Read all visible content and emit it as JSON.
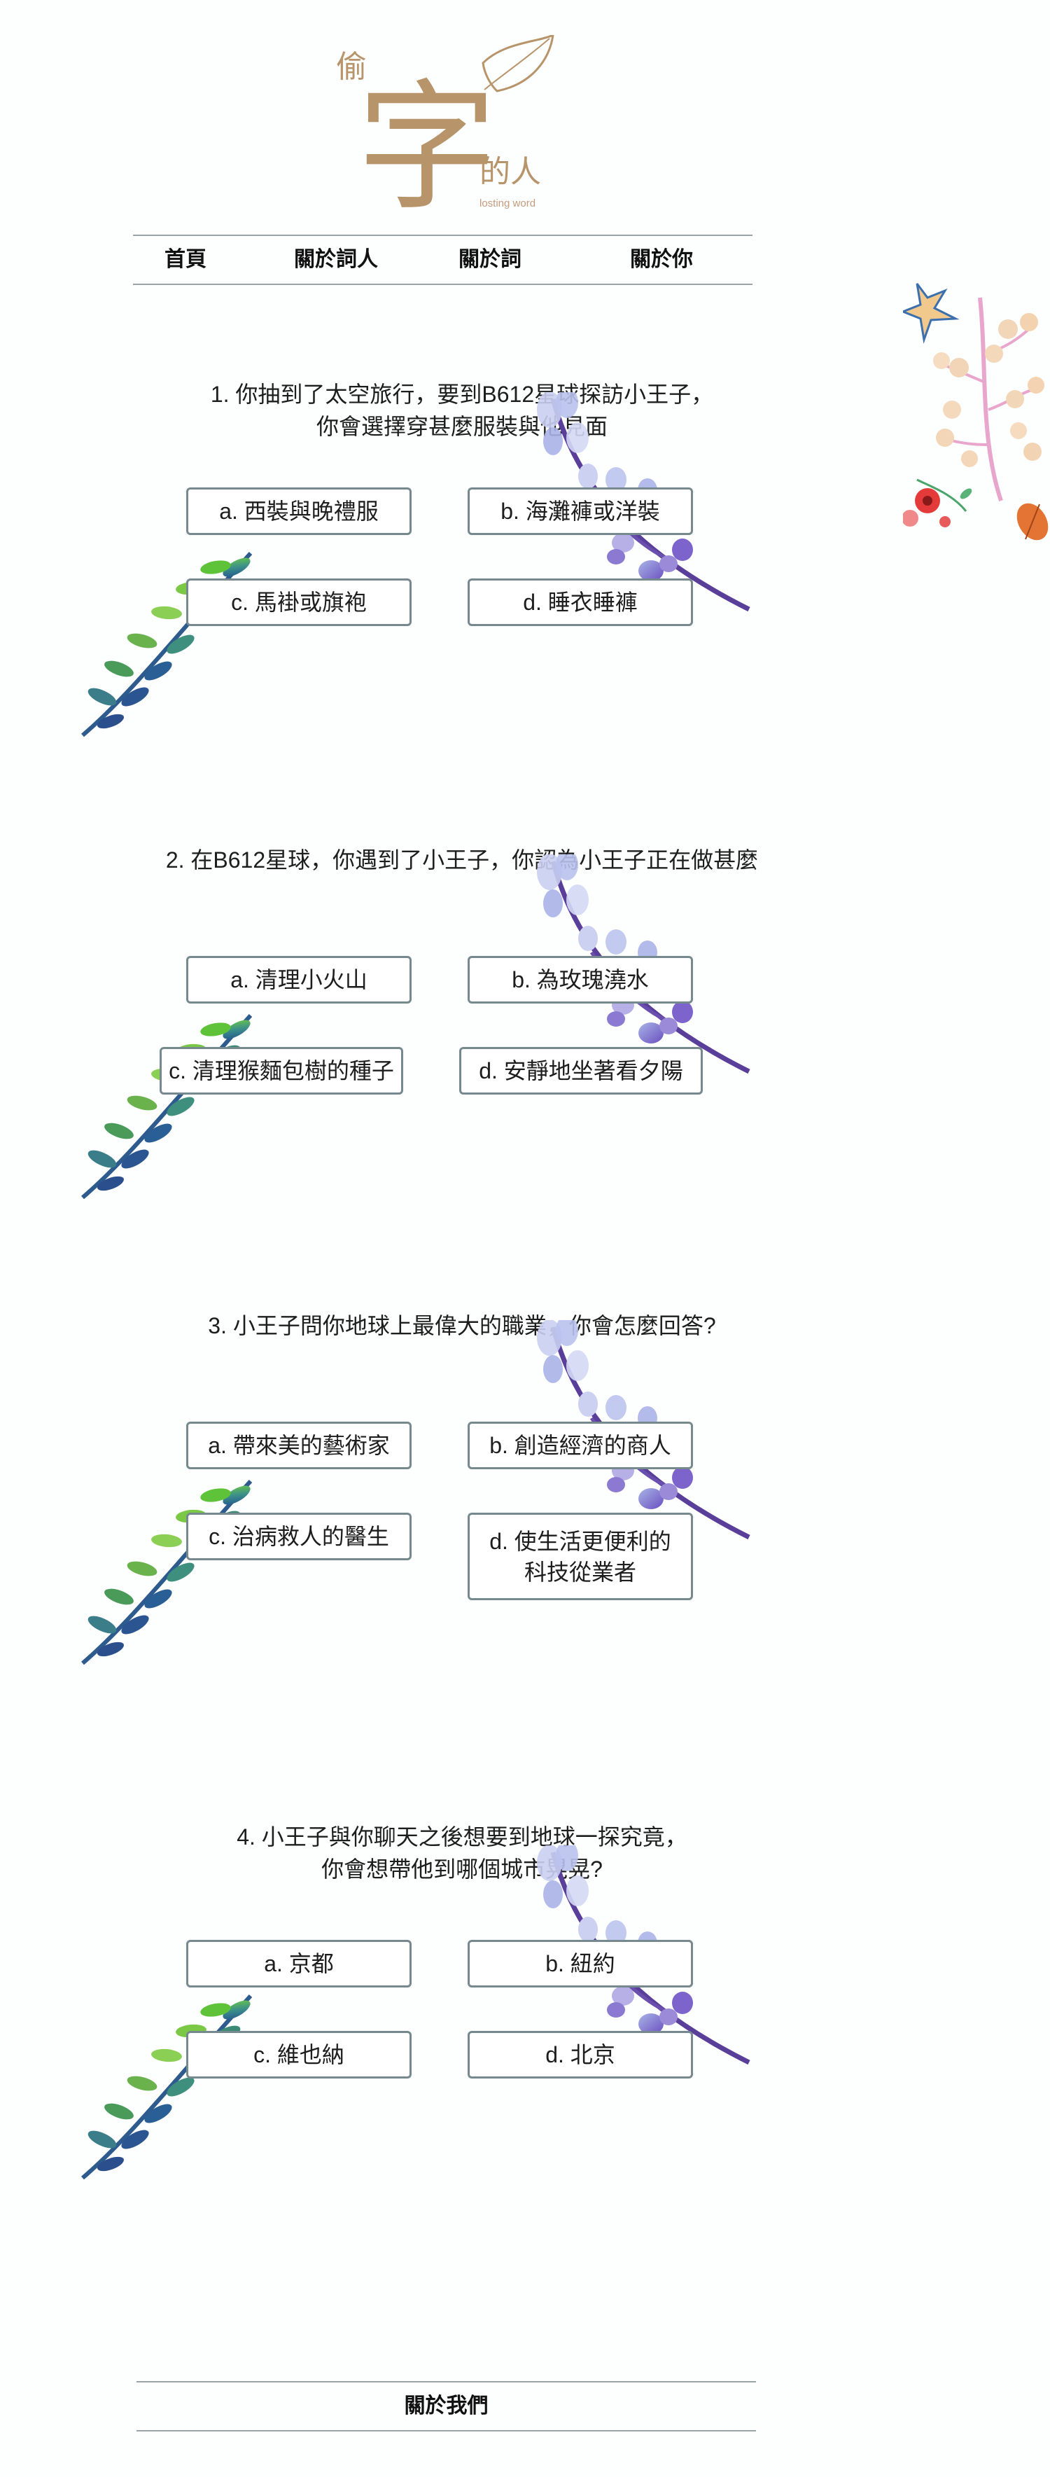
{
  "logo": {
    "char_top": "偷",
    "char_main": "字",
    "char_side": "的人",
    "subtitle": "losting word"
  },
  "nav": {
    "items": [
      {
        "label": "首頁"
      },
      {
        "label": "關於詞人"
      },
      {
        "label": "關於詞"
      },
      {
        "label": "關於你"
      }
    ]
  },
  "questions": [
    {
      "text": "1. 你抽到了太空旅行，要到B612星球探訪小王子，\n你會選擇穿甚麼服裝與他見面",
      "options": [
        "a. 西裝與晚禮服",
        "b. 海灘褲或洋裝",
        "c. 馬褂或旗袍",
        "d. 睡衣睡褲"
      ]
    },
    {
      "text": "2. 在B612星球，你遇到了小王子，你認為小王子正在做甚麼",
      "options": [
        "a. 清理小火山",
        "b. 為玫瑰澆水",
        "c. 清理猴麵包樹的種子",
        "d. 安靜地坐著看夕陽"
      ]
    },
    {
      "text": "3. 小王子問你地球上最偉大的職業，你會怎麼回答?",
      "options": [
        "a. 帶來美的藝術家",
        "b. 創造經濟的商人",
        "c. 治病救人的醫生",
        "d. 使生活更便利的\n科技從業者"
      ]
    },
    {
      "text": "4. 小王子與你聊天之後想要到地球一探究竟，\n你會想帶他到哪個城市晃晃?",
      "options": [
        "a. 京都",
        "b. 紐約",
        "c. 維也納",
        "d. 北京"
      ]
    }
  ],
  "footer": {
    "label": "關於我們"
  }
}
